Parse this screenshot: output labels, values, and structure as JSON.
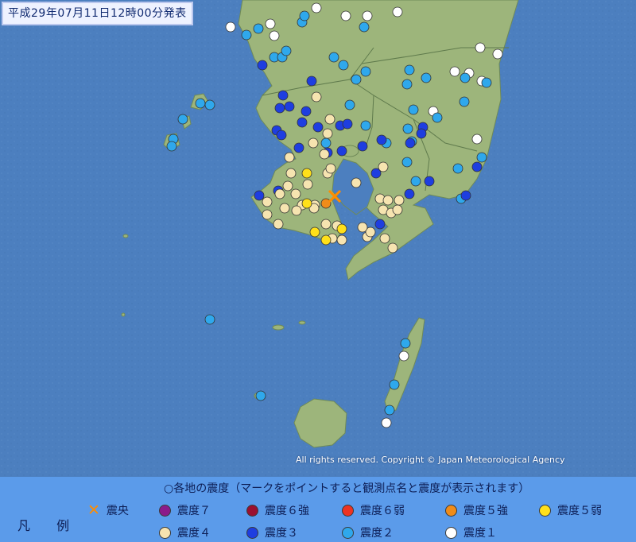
{
  "header": {
    "title": "平成29年07月11日12時00分発表"
  },
  "copyright": "All rights reserved. Copyright © Japan Meteorological Agency",
  "colors": {
    "sea": "#4c7fbf",
    "land": "#9db57b",
    "legend_bg": "#5b9bea",
    "shindo7": "#8b1a8b",
    "shindo6u": "#9a1030",
    "shindo6l": "#ee3322",
    "shindo5u": "#f08c1a",
    "shindo5l": "#ffe01a",
    "shindo4": "#f6e4b0",
    "shindo3": "#1e3ee0",
    "shindo2": "#2fa8ec",
    "shindo1": "#ffffff",
    "epicenter": "#ff8c00"
  },
  "legend": {
    "title": "○各地の震度（マークをポイントすると観測点名と震度が表示されます）",
    "hanrei": "凡 例",
    "items": [
      {
        "key": "epicenter",
        "label": "震央"
      },
      {
        "key": "shindo7",
        "label": "震度７"
      },
      {
        "key": "shindo6u",
        "label": "震度６強"
      },
      {
        "key": "shindo6l",
        "label": "震度６弱"
      },
      {
        "key": "shindo5u",
        "label": "震度５強"
      },
      {
        "key": "shindo5l",
        "label": "震度５弱"
      },
      {
        "key": "shindo4",
        "label": "震度４"
      },
      {
        "key": "shindo3",
        "label": "震度３"
      },
      {
        "key": "shindo2",
        "label": "震度２"
      },
      {
        "key": "shindo1",
        "label": "震度１"
      }
    ]
  }
}
